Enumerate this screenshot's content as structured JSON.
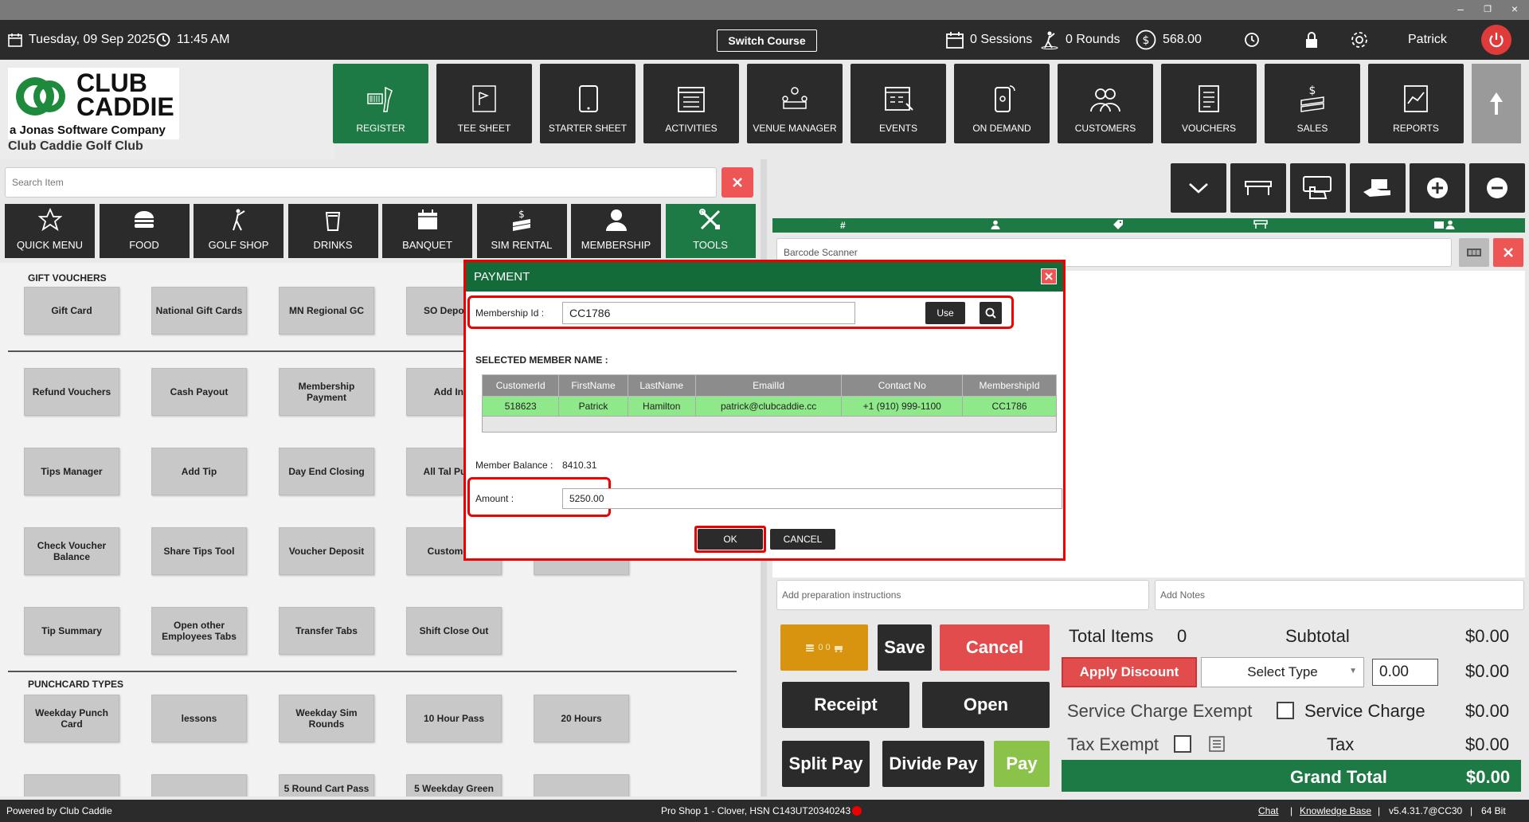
{
  "topbar": {
    "date": "Tuesday,  09 Sep 2025",
    "time": "11:45 AM",
    "switch_course": "Switch Course",
    "sessions": "0 Sessions",
    "rounds": "0 Rounds",
    "balance": "568.00",
    "user": "Patrick"
  },
  "logo": {
    "line1": "CLUB",
    "line2": "CADDIE",
    "tagline": "a Jonas Software Company",
    "club_name": "Club Caddie Golf Club"
  },
  "nav": [
    {
      "label": "REGISTER",
      "icon": "register-scanner-icon"
    },
    {
      "label": "TEE SHEET",
      "icon": "tee-sheet-icon"
    },
    {
      "label": "STARTER SHEET",
      "icon": "tablet-icon"
    },
    {
      "label": "ACTIVITIES",
      "icon": "calendar-list-icon"
    },
    {
      "label": "VENUE MANAGER",
      "icon": "venue-icon"
    },
    {
      "label": "EVENTS",
      "icon": "events-calendar-icon"
    },
    {
      "label": "ON DEMAND",
      "icon": "mobile-icon"
    },
    {
      "label": "CUSTOMERS",
      "icon": "customers-icon"
    },
    {
      "label": "VOUCHERS",
      "icon": "vouchers-icon"
    },
    {
      "label": "SALES",
      "icon": "sales-money-icon"
    },
    {
      "label": "REPORTS",
      "icon": "reports-icon"
    }
  ],
  "search": {
    "placeholder": "Search Item"
  },
  "categories": [
    {
      "label": "QUICK MENU"
    },
    {
      "label": "FOOD"
    },
    {
      "label": "GOLF SHOP"
    },
    {
      "label": "DRINKS"
    },
    {
      "label": "BANQUET"
    },
    {
      "label": "SIM RENTAL"
    },
    {
      "label": "MEMBERSHIP"
    },
    {
      "label": "TOOLS"
    }
  ],
  "sections": {
    "gift_vouchers": "GIFT VOUCHERS",
    "punchcard": "PUNCHCARD TYPES"
  },
  "tiles": [
    "Gift Card",
    "National Gift Cards",
    "MN Regional GC",
    "SO Deposit V",
    "Refund Vouchers",
    "Cash Payout",
    "Membership Payment",
    "Add Inve",
    "Tips Manager",
    "Add Tip",
    "Day End Closing",
    "All Tal Pull Ta",
    "Check Voucher Balance",
    "Share Tips Tool",
    "Voucher Deposit",
    "Customer L",
    "Tip Summary",
    "Open other Employees Tabs",
    "Transfer Tabs",
    "Shift Close Out"
  ],
  "punch_tiles": [
    "Weekday Punch Card",
    "lessons",
    "Weekday Sim Rounds",
    "10 Hour Pass",
    "20 Hours"
  ],
  "punch_tiles_partial": [
    "",
    "",
    "5 Round Cart Pass -",
    "5 Weekday Green",
    ""
  ],
  "right": {
    "barcode_placeholder": "Barcode Scanner",
    "prep_placeholder": "Add preparation instructions",
    "notes_placeholder": "Add Notes",
    "strip_hash": "#"
  },
  "actions": {
    "mini_counts": "0    0",
    "save": "Save",
    "cancel": "Cancel",
    "receipt": "Receipt",
    "open": "Open",
    "split_pay": "Split Pay",
    "divide_pay": "Divide Pay",
    "pay": "Pay"
  },
  "totals": {
    "total_items_label": "Total Items",
    "total_items": "0",
    "subtotal_label": "Subtotal",
    "subtotal": "$0.00",
    "apply_discount": "Apply Discount",
    "select_type": "Select Type",
    "discount_value": "0.00",
    "discount_amount": "$0.00",
    "service_exempt": "Service Charge Exempt",
    "service_charge_label": "Service Charge",
    "service_charge": "$0.00",
    "tax_exempt": "Tax Exempt",
    "tax_label": "Tax",
    "tax": "$0.00",
    "grand_total_label": "Grand Total",
    "grand_total": "$0.00"
  },
  "modal": {
    "title": "PAYMENT",
    "membership_label": "Membership Id :",
    "membership_value": "CC1786",
    "use": "Use",
    "selected_label": "SELECTED MEMBER NAME :",
    "columns": [
      "CustomerId",
      "FirstName",
      "LastName",
      "EmailId",
      "Contact No",
      "MembershipId"
    ],
    "row": [
      "518623",
      "Patrick",
      "Hamilton",
      "patrick@clubcaddie.cc",
      "+1 (910) 999-1100",
      "CC1786"
    ],
    "balance_label": "Member Balance :",
    "balance": "8410.31",
    "amount_label": "Amount :",
    "amount": "5250.00",
    "ok": "OK",
    "cancel": "CANCEL"
  },
  "status": {
    "powered": "Powered by Club Caddie",
    "device": "Pro Shop 1 - Clover, HSN C143UT20340243",
    "chat": "Chat",
    "sep1": "|",
    "kb": "Knowledge Base",
    "sep2": "|",
    "version": "v5.4.31.7@CC30",
    "sep3": "|",
    "bits": "64 Bit"
  },
  "colors": {
    "brand_green": "#1e7a45",
    "danger": "#e24c4c",
    "dark": "#2b2b2b",
    "pay_green": "#8bc34a",
    "mini_orange": "#d8930f"
  }
}
